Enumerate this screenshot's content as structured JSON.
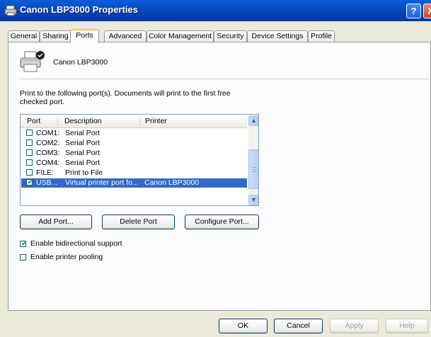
{
  "window": {
    "title": "Canon LBP3000 Properties"
  },
  "titlebar_buttons": {
    "help": "?",
    "close": "X"
  },
  "tabs": [
    {
      "label": "General"
    },
    {
      "label": "Sharing"
    },
    {
      "label": "Ports"
    },
    {
      "label": "Advanced"
    },
    {
      "label": "Color Management"
    },
    {
      "label": "Security"
    },
    {
      "label": "Device Settings"
    },
    {
      "label": "Profile"
    }
  ],
  "active_tab": "Ports",
  "printer": {
    "name": "Canon LBP3000",
    "icon": "printer-icon"
  },
  "description": "Print to the following port(s). Documents will print to the first free checked port.",
  "port_list": {
    "columns": [
      "Port",
      "Description",
      "Printer"
    ],
    "rows": [
      {
        "port": "COM1:",
        "description": "Serial Port",
        "printer": "",
        "checked": false,
        "selected": false
      },
      {
        "port": "COM2:",
        "description": "Serial Port",
        "printer": "",
        "checked": false,
        "selected": false
      },
      {
        "port": "COM3:",
        "description": "Serial Port",
        "printer": "",
        "checked": false,
        "selected": false
      },
      {
        "port": "COM4:",
        "description": "Serial Port",
        "printer": "",
        "checked": false,
        "selected": false
      },
      {
        "port": "FILE:",
        "description": "Print to File",
        "printer": "",
        "checked": false,
        "selected": false
      },
      {
        "port": "USB...",
        "description": "Virtual printer port fo...",
        "printer": "Canon LBP3000",
        "checked": true,
        "selected": true
      }
    ]
  },
  "port_buttons": {
    "add": "Add Port...",
    "delete": "Delete Port",
    "configure": "Configure Port..."
  },
  "options": {
    "bidirectional": {
      "label": "Enable bidirectional support",
      "checked": true
    },
    "pooling": {
      "label": "Enable printer pooling",
      "checked": false
    }
  },
  "dialog_buttons": {
    "ok": "OK",
    "cancel": "Cancel",
    "apply": "Apply",
    "help": "Help"
  },
  "colors": {
    "titlebar": "#0A5FD8",
    "selection": "#316AC5",
    "active_tab_accent": "#FFC83C",
    "dialog_bg": "#ECE9D8"
  }
}
